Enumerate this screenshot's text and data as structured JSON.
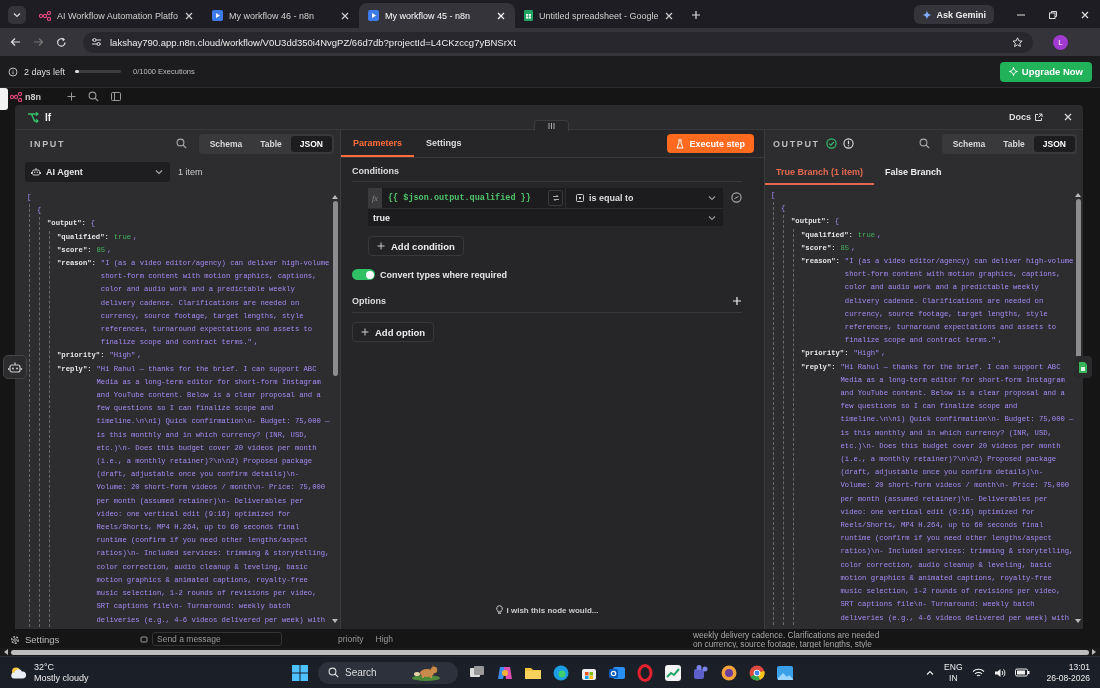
{
  "browser": {
    "tabs": [
      {
        "title": "AI Workflow Automation Platfo",
        "kind": "workflow",
        "selected": false
      },
      {
        "title": "My workflow 46 - n8n",
        "kind": "video",
        "selected": false
      },
      {
        "title": "My workflow 45 - n8n",
        "kind": "video",
        "selected": true
      },
      {
        "title": "Untitled spreadsheet - Google",
        "kind": "sheet",
        "selected": false
      }
    ],
    "gemini": "Ask Gemini",
    "url": "lakshay790.app.n8n.cloud/workflow/V0U3dd350i4NvgPZ/66d7db?projectId=L4CKzccg7yBNSrXt",
    "profile": "L"
  },
  "trial": {
    "days_left": "2 days left",
    "level": 0,
    "executions": "0/1000 Executions",
    "upgrade": "Upgrade Now"
  },
  "canvas": {
    "logo": "n8n",
    "settings": "Settings",
    "chat_input": {
      "placeholder": "Send a message"
    },
    "node_field": "priority",
    "node_value": "High",
    "note_lines": [
      "weekly delivery cadence. Clarifications are needed",
      "on currency, source footage, target lengths, style"
    ]
  },
  "node": {
    "title": "If",
    "docs": "Docs",
    "input": {
      "label": "INPUT",
      "views": [
        {
          "label": "Schema",
          "selected": false
        },
        {
          "label": "Table",
          "selected": false
        },
        {
          "label": "JSON",
          "selected": true
        }
      ],
      "source": "AI Agent",
      "count": "1 item",
      "json": {
        "value": "[",
        "kind": "punct",
        "children": [
          {
            "value": "{",
            "kind": "punct",
            "children": [
              {
                "key": "\"output\":",
                "value": "{",
                "kind": "punct",
                "children": [
                  {
                    "key": "\"qualified\":",
                    "value": "true",
                    "kind": "boolean",
                    "end": ","
                  },
                  {
                    "key": "\"score\":",
                    "value": "85",
                    "kind": "number",
                    "end": ","
                  },
                  {
                    "key": "\"reason\":",
                    "value": "\"I (as a video editor/agency) can deliver high-volume short-form content with motion graphics, captions, color and audio work and a predictable weekly delivery cadence. Clarifications are needed on currency, source footage, target lengths, style references, turnaround expectations and assets to finalize scope and contract terms.\"",
                    "kind": "string",
                    "end": ","
                  },
                  {
                    "key": "\"priority\":",
                    "value": "\"High\"",
                    "kind": "string",
                    "end": ","
                  },
                  {
                    "key": "\"reply\":",
                    "value": "\"Hi Rahul — thanks for the brief. I can support ABC Media as a long-term editor for short-form Instagram and YouTube content. Below is a clear proposal and a few questions so I can finalize scope and timeline.\\n\\n1) Quick confirmation\\n- Budget: 75,000 — is this monthly and in which currency? (INR, USD, etc.)\\n- Does this budget cover 20 videos per month (i.e., a monthly retainer)?\\n\\n2) Proposed package (draft, adjustable once you confirm details)\\n- Volume: 20 short-form videos / month\\n- Price: 75,000 per month (assumed retainer)\\n- Deliverables per video: one vertical edit (9:16) optimized for Reels/Shorts, MP4 H.264, up to 60 seconds final runtime (confirm if you need other lengths/aspect ratios)\\n- Included services: trimming & storytelling, color correction, audio cleanup & leveling, basic motion graphics & animated captions, royalty-free music selection, 1-2 rounds of revisions per video, SRT captions file\\n- Turnaround: weekly batch deliveries (e.g., 4-6 videos delivered per week) with",
                    "kind": "string"
                  }
                ]
              }
            ]
          }
        ]
      }
    },
    "parameters": {
      "tabs": [
        {
          "label": "Parameters",
          "selected": true
        },
        {
          "label": "Settings",
          "selected": false
        }
      ],
      "execute": "Execute step",
      "conditions_label": "Conditions",
      "conditions": [
        {
          "badge": "fx",
          "left": "{{ $json.output.qualified }}",
          "operator": "is equal to",
          "right": "true"
        }
      ],
      "add_condition": "Add condition",
      "convert_types": {
        "label": "Convert types where required",
        "on": true
      },
      "options_label": "Options",
      "add_option": "Add option",
      "feedback": "I wish this node would..."
    },
    "output": {
      "label": "OUTPUT",
      "views": [
        {
          "label": "Schema",
          "selected": false
        },
        {
          "label": "Table",
          "selected": false
        },
        {
          "label": "JSON",
          "selected": true
        }
      ],
      "branches": [
        {
          "label": "True Branch (1 item)",
          "selected": true
        },
        {
          "label": "False Branch",
          "selected": false
        }
      ],
      "json": {
        "value": "[",
        "kind": "punct",
        "children": [
          {
            "value": "{",
            "kind": "punct",
            "children": [
              {
                "key": "\"output\":",
                "value": "{",
                "kind": "punct",
                "children": [
                  {
                    "key": "\"qualified\":",
                    "value": "true",
                    "kind": "boolean",
                    "end": ","
                  },
                  {
                    "key": "\"score\":",
                    "value": "85",
                    "kind": "number",
                    "end": ","
                  },
                  {
                    "key": "\"reason\":",
                    "value": "\"I (as a video editor/agency) can deliver high-volume short-form content with motion graphics, captions, color and audio work and a predictable weekly delivery cadence. Clarifications are needed on currency, source footage, target lengths, style references, turnaround expectations and assets to finalize scope and contract terms.\"",
                    "kind": "string",
                    "end": ","
                  },
                  {
                    "key": "\"priority\":",
                    "value": "\"High\"",
                    "kind": "string",
                    "end": ","
                  },
                  {
                    "key": "\"reply\":",
                    "value": "\"Hi Rahul — thanks for the brief. I can support ABC Media as a long-term editor for short-form Instagram and YouTube content. Below is a clear proposal and a few questions so I can finalize scope and timeline.\\n\\n1) Quick confirmation\\n- Budget: 75,000 — is this monthly and in which currency? (INR, USD, etc.)\\n- Does this budget cover 20 videos per month (i.e., a monthly retainer)?\\n\\n2) Proposed package (draft, adjustable once you confirm details)\\n- Volume: 20 short-form videos / month\\n- Price: 75,000 per month (assumed retainer)\\n- Deliverables per video: one vertical edit (9:16) optimized for Reels/Shorts, MP4 H.264, up to 60 seconds final runtime (confirm if you need other lengths/aspect ratios)\\n- Included services: trimming & storytelling, color correction, audio cleanup & leveling, basic motion graphics & animated captions, royalty-free music selection, 1-2 rounds of revisions per video, SRT captions file\\n- Turnaround: weekly batch deliveries (e.g., 4-6 videos delivered per week) with",
                    "kind": "string"
                  }
                ]
              }
            ]
          }
        ]
      }
    }
  },
  "taskbar": {
    "temperature": "32°C",
    "weather": "Mostly cloudy",
    "search": {
      "placeholder": "Search"
    },
    "language": "ENG",
    "region": "IN",
    "time": "13:01",
    "date": "26-08-2026"
  }
}
